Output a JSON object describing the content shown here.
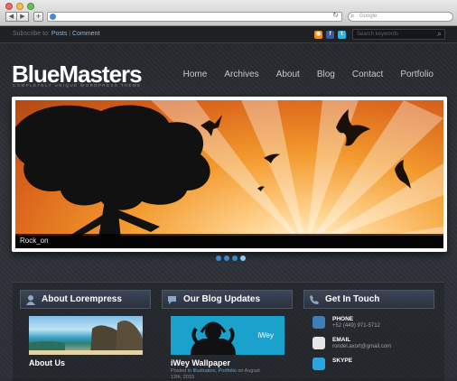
{
  "browser": {
    "back_glyph": "◀",
    "forward_glyph": "▶",
    "new_tab_glyph": "+",
    "reload_glyph": "↻",
    "search_placeholder": "Google"
  },
  "site": {
    "subscribe_prefix": "Subscribe to:",
    "subscribe_posts": "Posts",
    "subscribe_sep": " | ",
    "subscribe_comments": "Comment",
    "search_placeholder": "Search keywords",
    "logo": "BlueMasters",
    "tagline": "COMPLETELY UNIQUE WORDPRESS THEME",
    "nav": [
      "Home",
      "Archives",
      "About",
      "Blog",
      "Contact",
      "Portfolio"
    ],
    "slider_caption": "Rock_on",
    "slider_dots": 4,
    "slider_active_dot": 4
  },
  "widgets": {
    "about": {
      "title": "About Lorempress",
      "item_title": "About Us"
    },
    "blog": {
      "title": "Our Blog Updates",
      "image_text": "iWey",
      "post_title": "iWey Wallpaper",
      "posted_in": "Posted in",
      "cat1": "Illustration",
      "cat2": "Portfolio",
      "posted_on": "on August",
      "date_line": "12th, 2010"
    },
    "contact": {
      "title": "Get In Touch",
      "phone_label": "PHONE",
      "phone_value": "+52 (449) 971-5712",
      "email_label": "EMAIL",
      "email_value": "rondel.axort@gmail.com",
      "skype_label": "SKYPE"
    }
  },
  "colors": {
    "accent": "#3b89c8",
    "link": "#5ca8dc",
    "header_bg": "#2b3340"
  }
}
